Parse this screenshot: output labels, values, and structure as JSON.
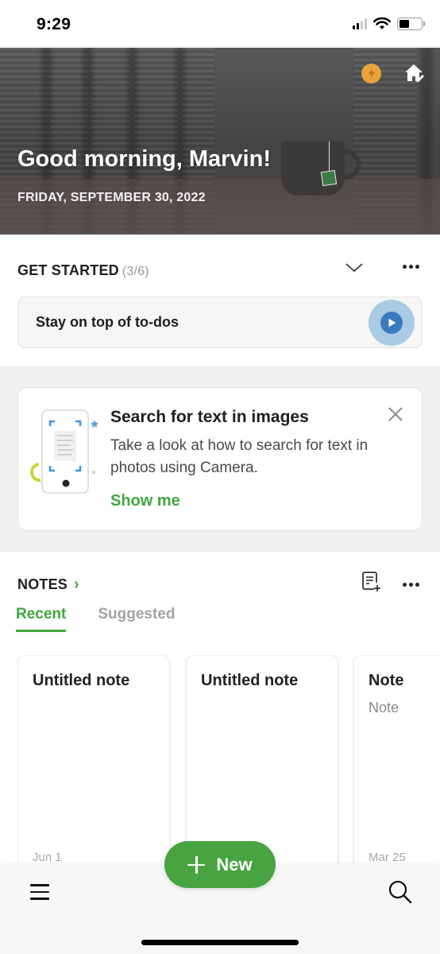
{
  "status_bar": {
    "time": "9:29",
    "signal_bars_active": 2,
    "signal_bars_total": 4,
    "battery_level": 0.45
  },
  "hero": {
    "greeting": "Good morning, Marvin!",
    "date": "FRIDAY, SEPTEMBER 30, 2022",
    "icons": [
      "bolt-icon",
      "home-edit-icon"
    ],
    "accent_color": "#e8a33b"
  },
  "get_started": {
    "title": "GET STARTED",
    "progress": "(3/6)",
    "todo_label": "Stay on top of to-dos",
    "play_color": "#3a7bbf"
  },
  "tip": {
    "title": "Search for text in images",
    "description": "Take a look at how to search for text in photos using Camera.",
    "link": "Show me",
    "link_color": "#3ea83f"
  },
  "notes": {
    "title": "NOTES",
    "chevron": "›",
    "tabs": [
      {
        "label": "Recent",
        "active": true
      },
      {
        "label": "Suggested",
        "active": false
      }
    ],
    "cards": [
      {
        "title": "Untitled note",
        "snippet": "",
        "date": "Jun 1"
      },
      {
        "title": "Untitled note",
        "snippet": "",
        "date": ""
      },
      {
        "title": "Note",
        "snippet": "Note",
        "date": "Mar 25"
      }
    ]
  },
  "bottom_bar": {
    "new_label": "New",
    "brand_color": "#48a441"
  }
}
